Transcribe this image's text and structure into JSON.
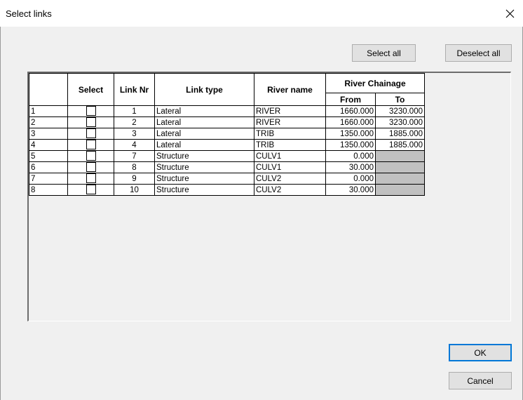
{
  "window": {
    "title": "Select links"
  },
  "buttons": {
    "select_all": "Select all",
    "deselect_all": "Deselect all",
    "ok": "OK",
    "cancel": "Cancel"
  },
  "grid": {
    "headers": {
      "select": "Select",
      "link_nr": "Link Nr",
      "link_type": "Link type",
      "river_name": "River name",
      "river_chainage": "River Chainage",
      "from": "From",
      "to": "To"
    },
    "rows": [
      {
        "index": "1",
        "selected": false,
        "link_nr": "1",
        "link_type": "Lateral",
        "river_name": "RIVER",
        "from": "1660.000",
        "to": "3230.000"
      },
      {
        "index": "2",
        "selected": false,
        "link_nr": "2",
        "link_type": "Lateral",
        "river_name": "RIVER",
        "from": "1660.000",
        "to": "3230.000"
      },
      {
        "index": "3",
        "selected": false,
        "link_nr": "3",
        "link_type": "Lateral",
        "river_name": "TRIB",
        "from": "1350.000",
        "to": "1885.000"
      },
      {
        "index": "4",
        "selected": false,
        "link_nr": "4",
        "link_type": "Lateral",
        "river_name": "TRIB",
        "from": "1350.000",
        "to": "1885.000"
      },
      {
        "index": "5",
        "selected": false,
        "link_nr": "7",
        "link_type": "Structure",
        "river_name": "CULV1",
        "from": "0.000",
        "to": ""
      },
      {
        "index": "6",
        "selected": false,
        "link_nr": "8",
        "link_type": "Structure",
        "river_name": "CULV1",
        "from": "30.000",
        "to": ""
      },
      {
        "index": "7",
        "selected": false,
        "link_nr": "9",
        "link_type": "Structure",
        "river_name": "CULV2",
        "from": "0.000",
        "to": ""
      },
      {
        "index": "8",
        "selected": false,
        "link_nr": "10",
        "link_type": "Structure",
        "river_name": "CULV2",
        "from": "30.000",
        "to": ""
      }
    ]
  },
  "colors": {
    "disabled_cell": "#c0c0c0",
    "default_button_border": "#0078d7"
  }
}
